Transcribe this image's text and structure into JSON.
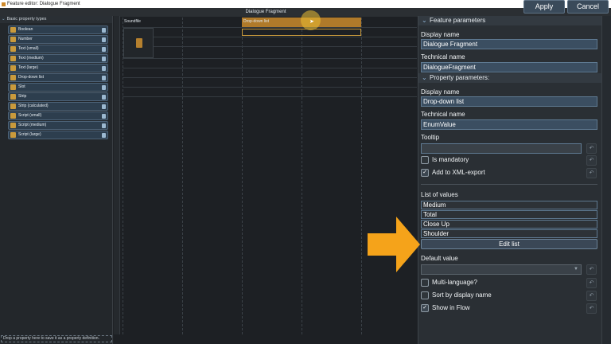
{
  "window": {
    "title": "Feature editor: Dialogue Fragment"
  },
  "toolbar": {
    "apply_label": "Apply",
    "cancel_label": "Cancel"
  },
  "palette": {
    "header": "Basic property types",
    "items": [
      "Boolean",
      "Number",
      "Text (small)",
      "Text (medium)",
      "Text (large)",
      "Drop-down list",
      "Slot",
      "Strip",
      "Strip (calculated)",
      "Script (small)",
      "Script (medium)",
      "Script (large)"
    ],
    "footer": "Drop a property here to save it as a property definition."
  },
  "canvas": {
    "title": "Dialogue Fragment",
    "columns": [
      "Soundfile",
      "Drop-down list"
    ]
  },
  "feature_params": {
    "section_title": "Feature parameters",
    "display_name_label": "Display name",
    "display_name_value": "Dialogue Fragment",
    "technical_name_label": "Technical name",
    "technical_name_value": "DialogueFragment"
  },
  "property_params": {
    "section_title": "Property parameters:",
    "display_name_label": "Display name",
    "display_name_value": "Drop-down list",
    "technical_name_label": "Technical name",
    "technical_name_value": "EnumValue",
    "tooltip_label": "Tooltip",
    "tooltip_value": "",
    "is_mandatory_label": "Is mandatory",
    "is_mandatory_checked": false,
    "xml_export_label": "Add to XML-export",
    "xml_export_checked": true,
    "list_of_values_label": "List of values",
    "values": [
      "Medium",
      "Total",
      "Close Up",
      "Shoulder"
    ],
    "edit_list_label": "Edit list",
    "default_value_label": "Default value",
    "default_value": "",
    "multilanguage_label": "Multi-language?",
    "multilanguage_checked": false,
    "sort_label": "Sort by display name",
    "sort_checked": false,
    "show_in_flow_label": "Show in Flow",
    "show_in_flow_checked": true
  },
  "colors": {
    "accent_orange": "#f5a31a",
    "selected_cell": "#b07a2a",
    "field_blue": "#3b4e61"
  }
}
